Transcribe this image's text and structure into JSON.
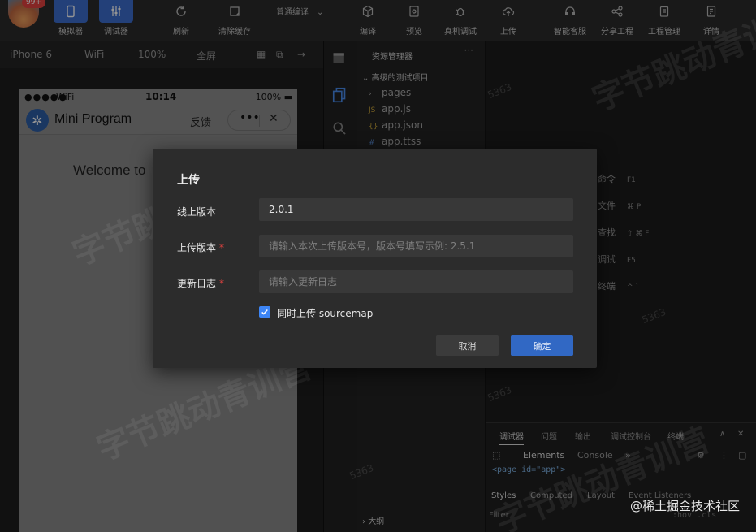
{
  "toolbar": {
    "badge": "99+",
    "buttons": [
      {
        "label": "模拟器",
        "icon": "phone-icon"
      },
      {
        "label": "调试器",
        "icon": "sliders-icon"
      },
      {
        "label": "刷新",
        "icon": "refresh-icon"
      },
      {
        "label": "清除缓存",
        "icon": "clear-cache-icon"
      },
      {
        "label": "编译",
        "icon": "cube-icon"
      },
      {
        "label": "预览",
        "icon": "preview-icon"
      },
      {
        "label": "真机调试",
        "icon": "bug-icon"
      },
      {
        "label": "上传",
        "icon": "cloud-upload-icon"
      },
      {
        "label": "智能客服",
        "icon": "headset-icon"
      },
      {
        "label": "分享工程",
        "icon": "share-icon"
      },
      {
        "label": "工程管理",
        "icon": "clipboard-icon"
      },
      {
        "label": "详情",
        "icon": "details-icon"
      }
    ],
    "compile_mode": "普通编译"
  },
  "simbar": {
    "device": "iPhone 6",
    "network": "WiFi",
    "zoom": "100%",
    "fullscreen": "全屏"
  },
  "phone": {
    "status_dots": "●●●●●",
    "status_wifi": "WiFi",
    "time": "10:14",
    "battery": "100%",
    "app_title": "Mini Program",
    "feedback": "反馈",
    "more": "•••",
    "close": "✕",
    "welcome": "Welcome to"
  },
  "explorer": {
    "header": "资源管理器",
    "header_more": "···",
    "project": "高级的测试项目",
    "files": [
      {
        "icon": "›",
        "name": "pages"
      },
      {
        "icon": "JS",
        "name": "app.js"
      },
      {
        "icon": "{}",
        "name": "app.json"
      },
      {
        "icon": "#",
        "name": "app.ttss"
      }
    ],
    "outline": "大纲"
  },
  "shortcuts": [
    {
      "label": "命令",
      "keys": "F1"
    },
    {
      "label": "文件",
      "keys": "⌘  P"
    },
    {
      "label": "查找",
      "keys": "⇧  ⌘  F"
    },
    {
      "label": "调试",
      "keys": "F5"
    },
    {
      "label": "终端",
      "keys": "^  `"
    }
  ],
  "debugger": {
    "tabs": [
      "调试器",
      "问题",
      "输出",
      "调试控制台",
      "终端"
    ],
    "subtabs": [
      "Elements",
      "Console"
    ],
    "dom_line": "<page id=\"app\">",
    "style_tabs": [
      "Styles",
      "Computed",
      "Layout",
      "Event Listeners"
    ],
    "filter": "Filter",
    "hov_cls": ":hov  .cls"
  },
  "watermark": {
    "text": "字节跳动青训营",
    "number": "5363"
  },
  "upload_dialog": {
    "title": "上传",
    "online_version_label": "线上版本",
    "online_version_value": "2.0.1",
    "upload_version_label": "上传版本",
    "upload_version_placeholder": "请输入本次上传版本号，版本号填写示例: 2.5.1",
    "changelog_label": "更新日志",
    "changelog_placeholder": "请输入更新日志",
    "required_mark": "*",
    "sourcemap_label": "同时上传 sourcemap",
    "sourcemap_checked": true,
    "cancel_label": "取消",
    "ok_label": "确定"
  },
  "corner_watermark": "@稀土掘金技术社区"
}
